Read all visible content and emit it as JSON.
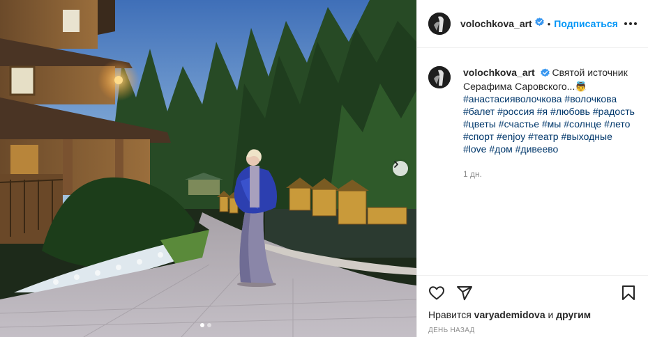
{
  "header": {
    "username": "volochkova_art",
    "separator": "•",
    "follow_label": "Подписаться",
    "more_icon": "more-horizontal-icon"
  },
  "caption": {
    "username": "volochkova_art",
    "text": "Святой источник Серафима Саровского...",
    "emoji": "👼",
    "hashtags": [
      "#анастасияволочкова",
      "#волочкова",
      "#балет",
      "#россия",
      "#я",
      "#любовь",
      "#радость",
      "#цветы",
      "#счастье",
      "#мы",
      "#солнце",
      "#лето",
      "#спорт",
      "#enjoy",
      "#театр",
      "#выходные",
      "#love",
      "#дом",
      "#дивеево"
    ],
    "time": "1 дн."
  },
  "actions": {
    "like_icon": "heart-icon",
    "share_icon": "paper-plane-icon",
    "save_icon": "bookmark-icon"
  },
  "likes": {
    "prefix": "Нравится",
    "user": "varyademidova",
    "conjunction": "и",
    "suffix": "другим"
  },
  "timestamp": "ДЕНЬ НАЗАД",
  "carousel": {
    "slides_total": 2,
    "active_index": 0
  },
  "colors": {
    "accent": "#0095f6",
    "verified": "#3897f0",
    "hashtag": "#00376b",
    "muted": "#8e8e8e",
    "text": "#262626"
  }
}
